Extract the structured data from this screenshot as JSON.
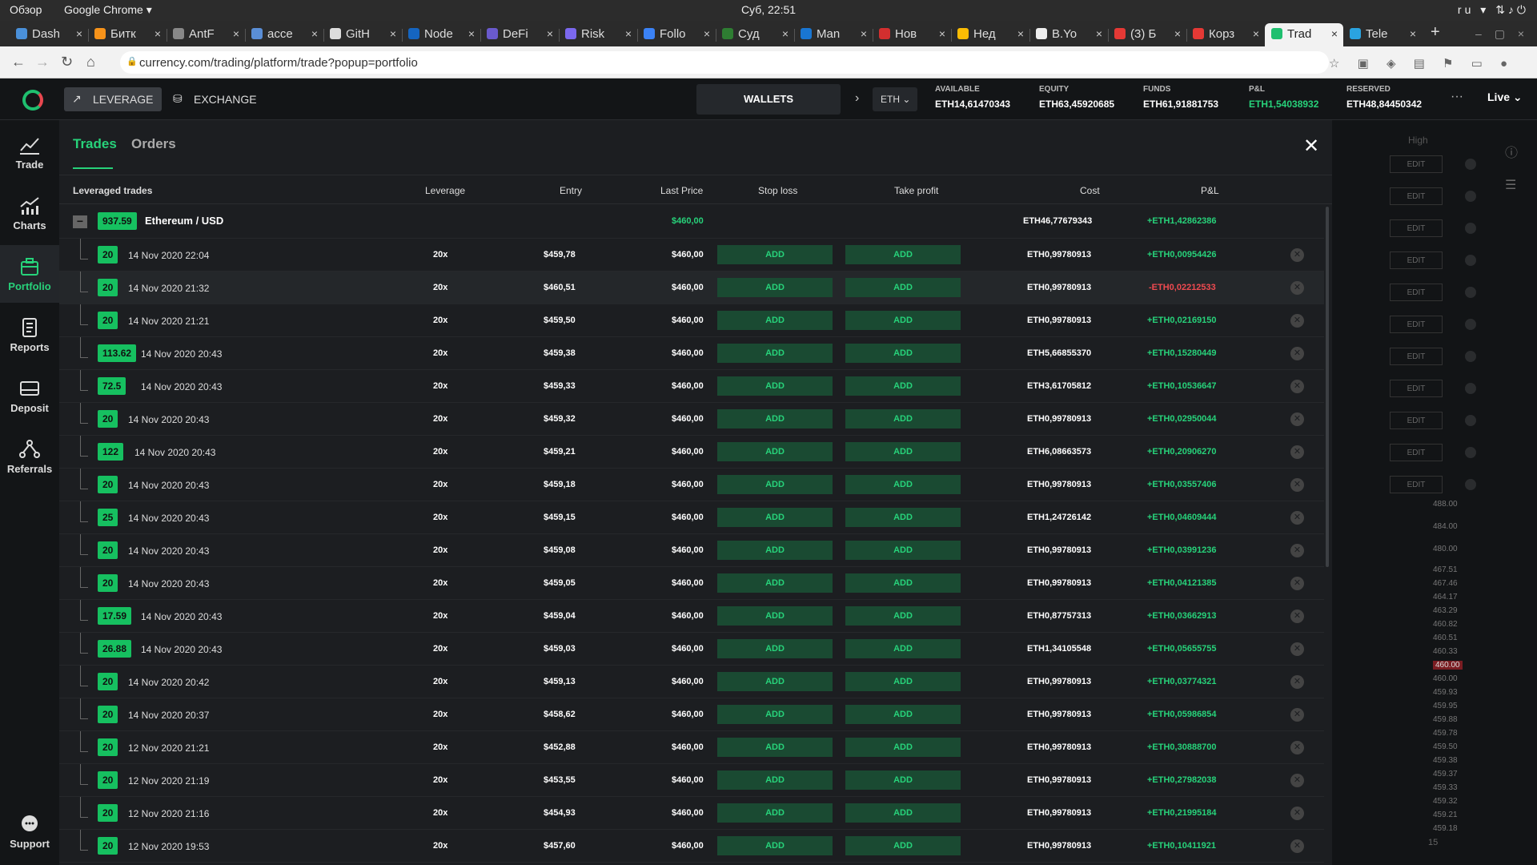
{
  "os": {
    "overview": "Обзор",
    "app": "Google Chrome ▾",
    "clock": "Суб, 22:51",
    "lang": "ru ▾"
  },
  "tabs": [
    {
      "title": "Dash",
      "color": "#4a90d9"
    },
    {
      "title": "Битк",
      "color": "#f7931a"
    },
    {
      "title": "AntF",
      "color": "#888888"
    },
    {
      "title": "acce",
      "color": "#5a8ed6"
    },
    {
      "title": "GitH",
      "color": "#dddddd"
    },
    {
      "title": "Node",
      "color": "#1565c0"
    },
    {
      "title": "DeFi",
      "color": "#6a5acd"
    },
    {
      "title": "Risk",
      "color": "#7b68ee"
    },
    {
      "title": "Follo",
      "color": "#3b82f6"
    },
    {
      "title": "Суд",
      "color": "#2e7d32"
    },
    {
      "title": "Man",
      "color": "#1976d2"
    },
    {
      "title": "Нов",
      "color": "#d32f2f"
    },
    {
      "title": "Нед",
      "color": "#fbbc04"
    },
    {
      "title": "B.Yo",
      "color": "#eeeeee"
    },
    {
      "title": "(3) Б",
      "color": "#e53935"
    },
    {
      "title": "Корз",
      "color": "#e53935"
    },
    {
      "title": "Trad",
      "color": "#1fbf6f"
    },
    {
      "title": "Tele",
      "color": "#2aa3e0"
    }
  ],
  "url": "currency.com/trading/platform/trade?popup=portfolio",
  "topbar": {
    "leverage": "LEVERAGE",
    "exchange": "EXCHANGE",
    "wallets": "WALLETS",
    "currency": "ETH",
    "live": "Live",
    "more": "···",
    "metrics": [
      {
        "label": "AVAILABLE",
        "value": "ETH14,61470343"
      },
      {
        "label": "EQUITY",
        "value": "ETH63,45920685"
      },
      {
        "label": "FUNDS",
        "value": "ETH61,91881753"
      },
      {
        "label": "P&L",
        "value": "ETH1,54038932"
      },
      {
        "label": "RESERVED",
        "value": "ETH48,84450342"
      }
    ]
  },
  "sidebar": [
    {
      "label": "Trade",
      "icon": "trade-chart-icon"
    },
    {
      "label": "Charts",
      "icon": "charts-icon"
    },
    {
      "label": "Portfolio",
      "icon": "portfolio-icon"
    },
    {
      "label": "Reports",
      "icon": "reports-icon"
    },
    {
      "label": "Deposit",
      "icon": "deposit-icon"
    },
    {
      "label": "Referrals",
      "icon": "referrals-icon"
    },
    {
      "label": "Support",
      "icon": "support-icon"
    }
  ],
  "panel": {
    "tab_trades": "Trades",
    "tab_orders": "Orders",
    "headers": {
      "name": "Leveraged trades",
      "leverage": "Leverage",
      "entry": "Entry",
      "last": "Last Price",
      "sl": "Stop loss",
      "tp": "Take profit",
      "cost": "Cost",
      "pnl": "P&L"
    },
    "group": {
      "amount": "937.59",
      "name": "Ethereum / USD",
      "last": "$460,00",
      "cost": "ETH46,77679343",
      "pnl": "+ETH1,42862386"
    },
    "add_label": "ADD",
    "rows": [
      {
        "amount": "20",
        "date": "14 Nov 2020 22:04",
        "lev": "20x",
        "entry": "$459,78",
        "last": "$460,00",
        "cost": "ETH0,99780913",
        "pnl": "+ETH0,00954426",
        "neg": false
      },
      {
        "amount": "20",
        "date": "14 Nov 2020 21:32",
        "lev": "20x",
        "entry": "$460,51",
        "last": "$460,00",
        "cost": "ETH0,99780913",
        "pnl": "-ETH0,02212533",
        "neg": true
      },
      {
        "amount": "20",
        "date": "14 Nov 2020 21:21",
        "lev": "20x",
        "entry": "$459,50",
        "last": "$460,00",
        "cost": "ETH0,99780913",
        "pnl": "+ETH0,02169150",
        "neg": false
      },
      {
        "amount": "113.62",
        "date": "14 Nov 2020 20:43",
        "lev": "20x",
        "entry": "$459,38",
        "last": "$460,00",
        "cost": "ETH5,66855370",
        "pnl": "+ETH0,15280449",
        "neg": false
      },
      {
        "amount": "72.5",
        "date": "14 Nov 2020 20:43",
        "lev": "20x",
        "entry": "$459,33",
        "last": "$460,00",
        "cost": "ETH3,61705812",
        "pnl": "+ETH0,10536647",
        "neg": false
      },
      {
        "amount": "20",
        "date": "14 Nov 2020 20:43",
        "lev": "20x",
        "entry": "$459,32",
        "last": "$460,00",
        "cost": "ETH0,99780913",
        "pnl": "+ETH0,02950044",
        "neg": false
      },
      {
        "amount": "122",
        "date": "14 Nov 2020 20:43",
        "lev": "20x",
        "entry": "$459,21",
        "last": "$460,00",
        "cost": "ETH6,08663573",
        "pnl": "+ETH0,20906270",
        "neg": false
      },
      {
        "amount": "20",
        "date": "14 Nov 2020 20:43",
        "lev": "20x",
        "entry": "$459,18",
        "last": "$460,00",
        "cost": "ETH0,99780913",
        "pnl": "+ETH0,03557406",
        "neg": false
      },
      {
        "amount": "25",
        "date": "14 Nov 2020 20:43",
        "lev": "20x",
        "entry": "$459,15",
        "last": "$460,00",
        "cost": "ETH1,24726142",
        "pnl": "+ETH0,04609444",
        "neg": false
      },
      {
        "amount": "20",
        "date": "14 Nov 2020 20:43",
        "lev": "20x",
        "entry": "$459,08",
        "last": "$460,00",
        "cost": "ETH0,99780913",
        "pnl": "+ETH0,03991236",
        "neg": false
      },
      {
        "amount": "20",
        "date": "14 Nov 2020 20:43",
        "lev": "20x",
        "entry": "$459,05",
        "last": "$460,00",
        "cost": "ETH0,99780913",
        "pnl": "+ETH0,04121385",
        "neg": false
      },
      {
        "amount": "17.59",
        "date": "14 Nov 2020 20:43",
        "lev": "20x",
        "entry": "$459,04",
        "last": "$460,00",
        "cost": "ETH0,87757313",
        "pnl": "+ETH0,03662913",
        "neg": false
      },
      {
        "amount": "26.88",
        "date": "14 Nov 2020 20:43",
        "lev": "20x",
        "entry": "$459,03",
        "last": "$460,00",
        "cost": "ETH1,34105548",
        "pnl": "+ETH0,05655755",
        "neg": false
      },
      {
        "amount": "20",
        "date": "14 Nov 2020 20:42",
        "lev": "20x",
        "entry": "$459,13",
        "last": "$460,00",
        "cost": "ETH0,99780913",
        "pnl": "+ETH0,03774321",
        "neg": false
      },
      {
        "amount": "20",
        "date": "14 Nov 2020 20:37",
        "lev": "20x",
        "entry": "$458,62",
        "last": "$460,00",
        "cost": "ETH0,99780913",
        "pnl": "+ETH0,05986854",
        "neg": false
      },
      {
        "amount": "20",
        "date": "12 Nov 2020 21:21",
        "lev": "20x",
        "entry": "$452,88",
        "last": "$460,00",
        "cost": "ETH0,99780913",
        "pnl": "+ETH0,30888700",
        "neg": false
      },
      {
        "amount": "20",
        "date": "12 Nov 2020 21:19",
        "lev": "20x",
        "entry": "$453,55",
        "last": "$460,00",
        "cost": "ETH0,99780913",
        "pnl": "+ETH0,27982038",
        "neg": false
      },
      {
        "amount": "20",
        "date": "12 Nov 2020 21:16",
        "lev": "20x",
        "entry": "$454,93",
        "last": "$460,00",
        "cost": "ETH0,99780913",
        "pnl": "+ETH0,21995184",
        "neg": false
      },
      {
        "amount": "20",
        "date": "12 Nov 2020 19:53",
        "lev": "20x",
        "entry": "$457,60",
        "last": "$460,00",
        "cost": "ETH0,99780913",
        "pnl": "+ETH0,10411921",
        "neg": false
      }
    ]
  },
  "right_panel": {
    "high": "High",
    "edit": "EDIT",
    "prices": [
      "488.00",
      "484.00",
      "480.00",
      "467.51",
      "467.46",
      "464.17",
      "463.29",
      "460.82",
      "460.51",
      "460.33",
      "460.00",
      "460.00",
      "459.93",
      "459.95",
      "459.88",
      "459.78",
      "459.50",
      "459.38",
      "459.37",
      "459.33",
      "459.32",
      "459.21",
      "459.18"
    ],
    "bottom": "15"
  }
}
